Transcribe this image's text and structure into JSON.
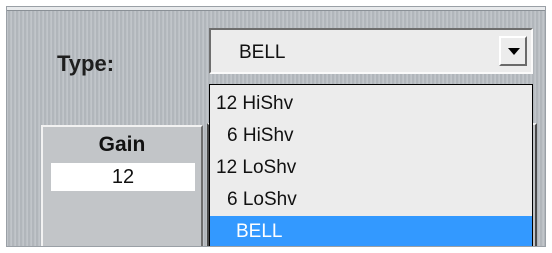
{
  "type_label": "Type:",
  "type_select": {
    "value": "BELL",
    "options": [
      "12 HiShv",
      "6 HiShv",
      "12 LoShv",
      "6 LoShv",
      "BELL"
    ],
    "selected_index": 4
  },
  "gain": {
    "header": "Gain",
    "value": "12"
  },
  "colors": {
    "selection": "#3399ff",
    "panel": "#b7bcc1"
  }
}
